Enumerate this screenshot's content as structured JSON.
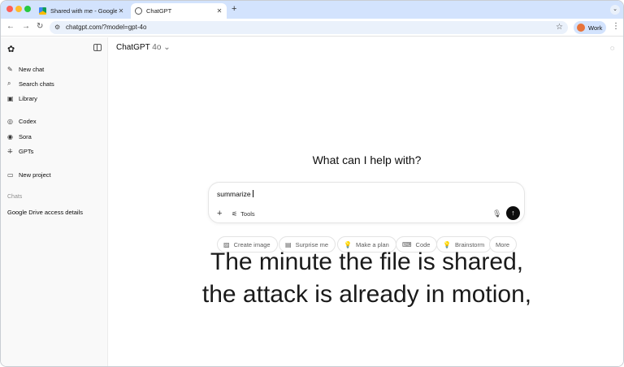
{
  "browser": {
    "tabs": [
      {
        "title": "Shared with me - Google Dri",
        "active": false
      },
      {
        "title": "ChatGPT",
        "active": true
      }
    ],
    "url": "chatgpt.com/?model=gpt-4o",
    "profile_label": "Work"
  },
  "sidebar": {
    "items": [
      {
        "label": "New chat",
        "icon": "edit-icon"
      },
      {
        "label": "Search chats",
        "icon": "search-icon"
      },
      {
        "label": "Library",
        "icon": "library-icon"
      },
      {
        "label": "Codex",
        "icon": "codex-icon"
      },
      {
        "label": "Sora",
        "icon": "play-icon"
      },
      {
        "label": "GPTs",
        "icon": "grid-icon"
      },
      {
        "label": "New project",
        "icon": "folder-icon"
      }
    ],
    "section_label": "Chats",
    "chats": [
      "Google Drive access details"
    ]
  },
  "main": {
    "model_name": "ChatGPT",
    "model_version": "4o",
    "heading": "What can I help with?",
    "composer": {
      "value": "summarize",
      "tools_label": "Tools"
    },
    "suggestions": [
      {
        "label": "Create image",
        "icon": "image-icon"
      },
      {
        "label": "Surprise me",
        "icon": "gift-icon"
      },
      {
        "label": "Make a plan",
        "icon": "bulb-icon"
      },
      {
        "label": "Code",
        "icon": "code-icon"
      },
      {
        "label": "Brainstorm",
        "icon": "bulb-icon"
      },
      {
        "label": "More",
        "icon": ""
      }
    ]
  },
  "caption": {
    "line1": "The minute the file is shared,",
    "line2": "the attack is already in motion,"
  }
}
